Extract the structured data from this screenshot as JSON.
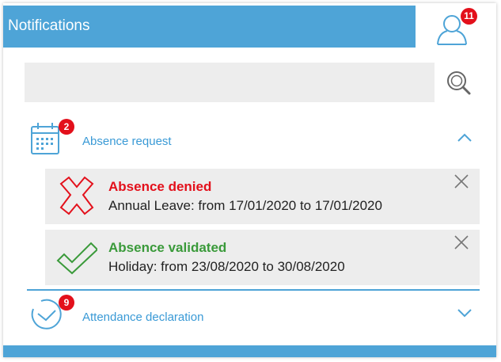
{
  "header": {
    "title": "Notifications",
    "user_badge_count": "11"
  },
  "search": {
    "value": "",
    "placeholder": ""
  },
  "sections": [
    {
      "label": "Absence request",
      "badge": "2",
      "icon": "calendar-icon",
      "expanded": true
    },
    {
      "label": "Attendance declaration",
      "badge": "9",
      "icon": "clock-icon",
      "expanded": false
    }
  ],
  "notifications": [
    {
      "title": "Absence denied",
      "body": "Annual Leave: from 17/01/2020 to 17/01/2020",
      "status": "denied",
      "color": "#e3101b"
    },
    {
      "title": "Absence validated",
      "body": "Holiday: from 23/08/2020 to 30/08/2020",
      "status": "validated",
      "color": "#3a9a3a"
    }
  ],
  "colors": {
    "accent": "#4ea4d7",
    "link": "#3a9ad6",
    "badge": "#e3101b",
    "denied": "#e3101b",
    "validated": "#3a9a3a"
  }
}
